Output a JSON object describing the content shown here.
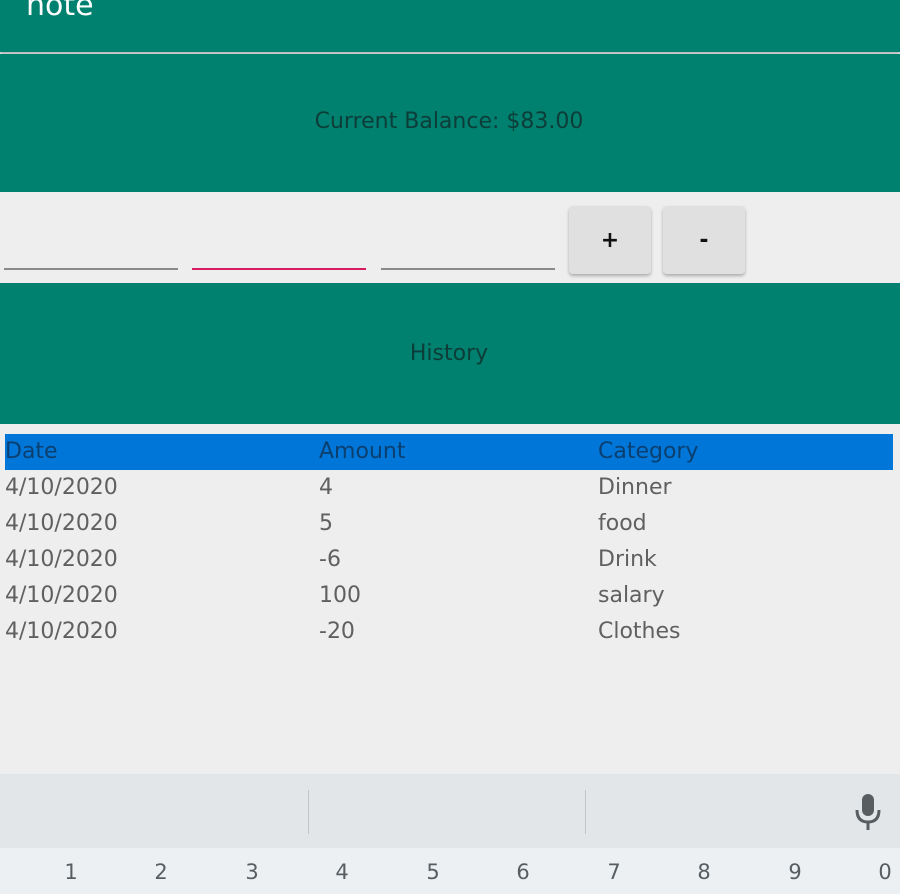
{
  "app": {
    "title": "note"
  },
  "balance": {
    "text": "Current Balance: $83.00"
  },
  "inputs": [
    {
      "value": "",
      "placeholder": ""
    },
    {
      "value": "",
      "placeholder": ""
    },
    {
      "value": "",
      "placeholder": ""
    }
  ],
  "buttons": {
    "add_label": "+",
    "subtract_label": "-"
  },
  "history": {
    "title": "History",
    "headers": [
      "Date",
      "Amount",
      "Category"
    ],
    "rows": [
      [
        "4/10/2020",
        "4",
        "Dinner"
      ],
      [
        "4/10/2020",
        "5",
        "food"
      ],
      [
        "4/10/2020",
        "-6",
        "Drink"
      ],
      [
        "4/10/2020",
        "100",
        "salary"
      ],
      [
        "4/10/2020",
        "-20",
        "Clothes"
      ]
    ]
  },
  "keyboard": {
    "number_keys": [
      "1",
      "2",
      "3",
      "4",
      "5",
      "6",
      "7",
      "8",
      "9",
      "0"
    ]
  },
  "colors": {
    "primary": "#00806f",
    "table_header": "#0077d8",
    "active_underline": "#d81b60"
  }
}
